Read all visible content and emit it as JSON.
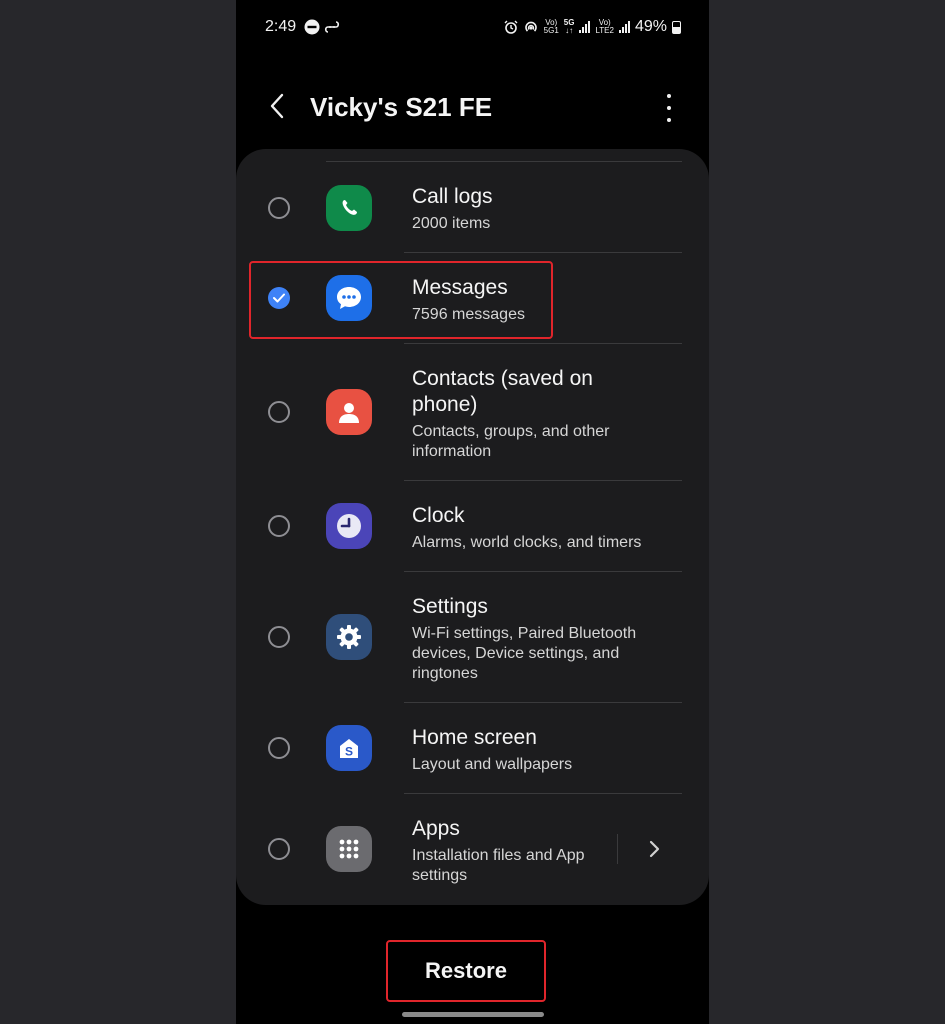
{
  "status_bar": {
    "time": "2:49",
    "volte1": "Vo)",
    "net1": "5G1",
    "net_5g": "5G",
    "volte2": "Vo)",
    "net2": "LTE2",
    "battery": "49%",
    "icons": [
      "do-not-disturb-icon",
      "link-icon",
      "alarm-icon",
      "hotspot-icon",
      "signal-icon",
      "battery-icon"
    ]
  },
  "header": {
    "title": "Vicky's S21 FE"
  },
  "items": [
    {
      "title": "Call logs",
      "subtitle": "2000 items",
      "checked": false,
      "icon": "phone-icon",
      "icon_color": "#0f8a4a"
    },
    {
      "title": "Messages",
      "subtitle": "7596 messages",
      "checked": true,
      "icon": "chat-bubble-icon",
      "icon_color": "#1e6fe8"
    },
    {
      "title": "Contacts (saved on phone)",
      "subtitle": "Contacts, groups, and other information",
      "checked": false,
      "icon": "person-icon",
      "icon_color": "#e85142"
    },
    {
      "title": "Clock",
      "subtitle": "Alarms, world clocks, and timers",
      "checked": false,
      "icon": "clock-icon",
      "icon_color": "#4b45b8"
    },
    {
      "title": "Settings",
      "subtitle": "Wi-Fi settings, Paired Bluetooth devices, Device settings, and ringtones",
      "checked": false,
      "icon": "gear-icon",
      "icon_color": "#2f4e7a"
    },
    {
      "title": "Home screen",
      "subtitle": "Layout and wallpapers",
      "checked": false,
      "icon": "home-s-icon",
      "icon_color": "#2a59c9"
    },
    {
      "title": "Apps",
      "subtitle": "Installation files and App settings",
      "checked": false,
      "icon": "apps-grid-icon",
      "icon_color": "#6b6b6f"
    }
  ],
  "footer": {
    "restore_label": "Restore"
  },
  "colors": {
    "accent": "#3e82f7",
    "highlight": "#e0252b",
    "background": "#000000",
    "card": "#1c1c1e"
  }
}
